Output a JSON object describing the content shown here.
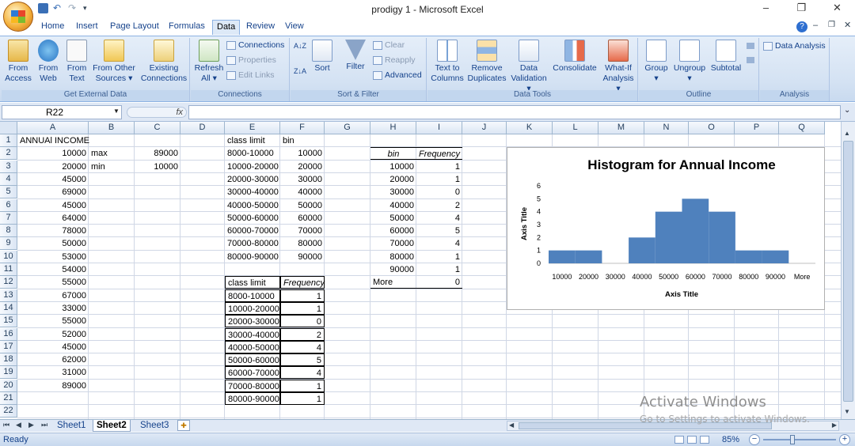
{
  "window": {
    "title": "prodigy 1 - Microsoft Excel"
  },
  "tabs": [
    "Home",
    "Insert",
    "Page Layout",
    "Formulas",
    "Data",
    "Review",
    "View"
  ],
  "ribbon": {
    "groups": [
      "Get External Data",
      "Connections",
      "Sort & Filter",
      "Data Tools",
      "Outline",
      "Analysis"
    ],
    "get_external": [
      {
        "l1": "From",
        "l2": "Access"
      },
      {
        "l1": "From",
        "l2": "Web"
      },
      {
        "l1": "From",
        "l2": "Text"
      },
      {
        "l1": "From Other",
        "l2": "Sources ▾"
      },
      {
        "l1": "Existing",
        "l2": "Connections"
      }
    ],
    "refresh": {
      "l1": "Refresh",
      "l2": "All ▾"
    },
    "connections_small": [
      "Connections",
      "Properties",
      "Edit Links"
    ],
    "sort": "Sort",
    "filter": "Filter",
    "filter_small": [
      "Clear",
      "Reapply",
      "Advanced"
    ],
    "data_tools": [
      {
        "l1": "Text to",
        "l2": "Columns"
      },
      {
        "l1": "Remove",
        "l2": "Duplicates"
      },
      {
        "l1": "Data",
        "l2": "Validation ▾"
      },
      {
        "l1": "Consolidate",
        "l2": ""
      },
      {
        "l1": "What-If",
        "l2": "Analysis ▾"
      }
    ],
    "outline": [
      {
        "l1": "Group",
        "l2": "▾"
      },
      {
        "l1": "Ungroup",
        "l2": "▾"
      },
      {
        "l1": "Subtotal",
        "l2": ""
      }
    ],
    "data_analysis": "Data Analysis"
  },
  "formula_bar": {
    "namebox": "R22",
    "fx": "fx",
    "formula": ""
  },
  "columns": [
    "A",
    "B",
    "C",
    "D",
    "E",
    "F",
    "G",
    "H",
    "I",
    "J",
    "K",
    "L",
    "M",
    "N",
    "O",
    "P",
    "Q"
  ],
  "rows": [
    "1",
    "2",
    "3",
    "4",
    "5",
    "6",
    "7",
    "8",
    "9",
    "10",
    "11",
    "12",
    "13",
    "14",
    "15",
    "16",
    "17",
    "18",
    "19",
    "20",
    "21",
    "22"
  ],
  "colA": {
    "header": "ANNUAl INCOME",
    "values": [
      "10000",
      "20000",
      "45000",
      "69000",
      "45000",
      "64000",
      "78000",
      "50000",
      "53000",
      "54000",
      "55000",
      "67000",
      "33000",
      "55000",
      "52000",
      "45000",
      "62000",
      "31000",
      "89000"
    ]
  },
  "colB": [
    "max",
    "min"
  ],
  "colC": [
    "89000",
    "10000"
  ],
  "colE": {
    "header": "class limit",
    "values": [
      "8000-10000",
      "10000-20000",
      "20000-30000",
      "30000-40000",
      "40000-50000",
      "50000-60000",
      "60000-70000",
      "70000-80000",
      "80000-90000"
    ]
  },
  "colF": {
    "header": "bin",
    "values": [
      "10000",
      "20000",
      "30000",
      "40000",
      "50000",
      "60000",
      "70000",
      "80000",
      "90000"
    ]
  },
  "freq_table2": {
    "h1": "class limit",
    "h2": "Frequency",
    "rows": [
      {
        "c": "8000-10000",
        "f": "1"
      },
      {
        "c": "10000-20000",
        "f": "1"
      },
      {
        "c": "20000-30000",
        "f": "0"
      },
      {
        "c": "30000-40000",
        "f": "2"
      },
      {
        "c": "40000-50000",
        "f": "4"
      },
      {
        "c": "50000-60000",
        "f": "5"
      },
      {
        "c": "60000-70000",
        "f": "4"
      },
      {
        "c": "70000-80000",
        "f": "1"
      },
      {
        "c": "80000-90000",
        "f": "1"
      }
    ]
  },
  "bin_table": {
    "h1": "bin",
    "h2": "Frequency",
    "rows": [
      {
        "b": "10000",
        "f": "1"
      },
      {
        "b": "20000",
        "f": "1"
      },
      {
        "b": "30000",
        "f": "0"
      },
      {
        "b": "40000",
        "f": "2"
      },
      {
        "b": "50000",
        "f": "4"
      },
      {
        "b": "60000",
        "f": "5"
      },
      {
        "b": "70000",
        "f": "4"
      },
      {
        "b": "80000",
        "f": "1"
      },
      {
        "b": "90000",
        "f": "1"
      },
      {
        "b": "More",
        "f": "0"
      }
    ]
  },
  "chart_data": {
    "type": "bar",
    "title": "Histogram for Annual Income",
    "xlabel": "Axis Title",
    "ylabel": "Axis Title",
    "categories": [
      "10000",
      "20000",
      "30000",
      "40000",
      "50000",
      "60000",
      "70000",
      "80000",
      "90000",
      "More"
    ],
    "values": [
      1,
      1,
      0,
      2,
      4,
      5,
      4,
      1,
      1,
      0
    ],
    "ylim": [
      0,
      6
    ],
    "yticks": [
      "0",
      "1",
      "2",
      "3",
      "4",
      "5",
      "6"
    ],
    "color": "#4f81bd",
    "grid": false
  },
  "sheet_tabs": [
    "Sheet1",
    "Sheet2",
    "Sheet3"
  ],
  "active_sheet": "Sheet2",
  "status": {
    "text": "Ready",
    "zoom": "85%"
  },
  "watermark": {
    "line1": "Activate Windows",
    "line2": "Go to Settings to activate Windows."
  }
}
